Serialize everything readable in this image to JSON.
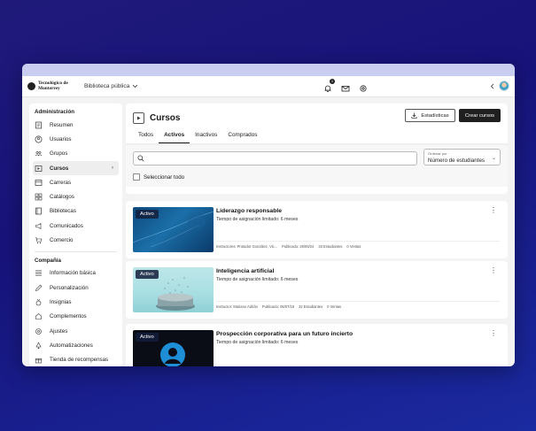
{
  "topbar": {
    "logo_text": "Tecnológico de Monterrey",
    "library": "Biblioteca pública",
    "notification_count": "1"
  },
  "sidebar": {
    "section1": "Administración",
    "items": [
      {
        "label": "Resumen",
        "icon": "summary-icon"
      },
      {
        "label": "Usuarios",
        "icon": "user-icon"
      },
      {
        "label": "Grupos",
        "icon": "group-icon"
      },
      {
        "label": "Cursos",
        "icon": "course-icon",
        "active": true
      },
      {
        "label": "Carreras",
        "icon": "career-icon"
      },
      {
        "label": "Catálogos",
        "icon": "catalog-icon"
      },
      {
        "label": "Bibliotecas",
        "icon": "library-icon"
      },
      {
        "label": "Comunicados",
        "icon": "megaphone-icon"
      },
      {
        "label": "Comercio",
        "icon": "cart-icon"
      }
    ],
    "section2": "Compañía",
    "items2": [
      {
        "label": "Información básica",
        "icon": "list-icon"
      },
      {
        "label": "Personalización",
        "icon": "pen-icon"
      },
      {
        "label": "Insignias",
        "icon": "badge-icon"
      },
      {
        "label": "Complementos",
        "icon": "puzzle-icon"
      },
      {
        "label": "Ajustes",
        "icon": "settings-icon"
      },
      {
        "label": "Automatizaciones",
        "icon": "automation-icon"
      },
      {
        "label": "Tienda de recompensas",
        "icon": "gift-icon"
      }
    ]
  },
  "main": {
    "title": "Cursos",
    "stats_button": "Estadísticas",
    "create_button": "Crear cursos",
    "tabs": [
      "Todos",
      "Activos",
      "Inactivos",
      "Comprados"
    ],
    "active_tab": "Activos",
    "sort_label": "Ordenar por",
    "sort_value": "Número de estudiantes",
    "select_all": "Seleccionar todo"
  },
  "courses": [
    {
      "status": "Activo",
      "title": "Liderazgo responsable",
      "subtitle": "Tiempo de asignación limitado: 6 meses",
      "instructor": "Instructores: Protador González, Vic...",
      "published": "Publicado: 26/05/24",
      "students": "33 Estudiantes",
      "sales": "0 Ventas"
    },
    {
      "status": "Activo",
      "title": "Inteligencia artificial",
      "subtitle": "Tiempo de asignación limitado: 6 meses",
      "instructor": "Instructor: Mariano Adrián",
      "published": "Publicado: 06/07/18",
      "students": "32 Estudiantes",
      "sales": "0 Ventas"
    },
    {
      "status": "Activo",
      "title": "Prospección corporativa para un futuro incierto",
      "subtitle": "Tiempo de asignación limitado: 6 meses"
    }
  ]
}
